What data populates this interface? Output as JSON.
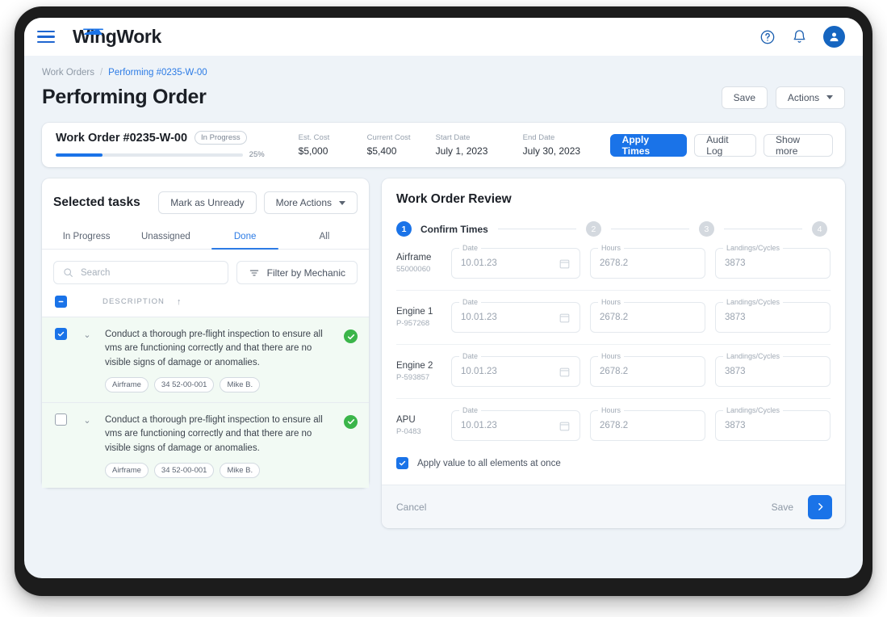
{
  "brand": {
    "name": "WingWork",
    "accent": "#1a73e8",
    "green": "#3bb54a"
  },
  "topnav": {
    "menu_icon": "hamburger-icon",
    "help_icon": "help-circle-icon",
    "notifications_icon": "bell-icon",
    "avatar_icon": "user-avatar-icon"
  },
  "breadcrumb": {
    "root": "Work Orders",
    "separator": "/",
    "current": "Performing #0235-W-00"
  },
  "header": {
    "title": "Performing Order",
    "save_label": "Save",
    "actions_label": "Actions"
  },
  "summary": {
    "title": "Work Order #0235-W-00",
    "status": "In Progress",
    "progress_pct": 25,
    "progress_label": "25%",
    "metrics": [
      {
        "label": "Est. Cost",
        "value": "$5,000"
      },
      {
        "label": "Current Cost",
        "value": "$5,400"
      },
      {
        "label": "Start Date",
        "value": "July 1, 2023"
      },
      {
        "label": "End Date",
        "value": "July 30, 2023"
      }
    ],
    "apply_times_label": "Apply Times",
    "audit_log_label": "Audit Log",
    "show_more_label": "Show more"
  },
  "tasks_panel": {
    "title": "Selected tasks",
    "mark_unready_label": "Mark as Unready",
    "more_actions_label": "More Actions",
    "tabs": [
      {
        "label": "In Progress",
        "active": false
      },
      {
        "label": "Unassigned",
        "active": false
      },
      {
        "label": "Done",
        "active": true
      },
      {
        "label": "All",
        "active": false
      }
    ],
    "search_placeholder": "Search",
    "search_value": "",
    "filter_label": "Filter by Mechanic",
    "column_header": "DESCRIPTION",
    "sort_arrow": "↑",
    "select_all_state": "indeterminate",
    "rows": [
      {
        "checked": true,
        "text": "Conduct a thorough pre-flight inspection to ensure all  vms are functioning correctly and that there are no visible signs of damage or anomalies.",
        "tags": [
          "Airframe",
          "34 52-00-001",
          "Mike B."
        ],
        "status_icon": "check-circle-icon"
      },
      {
        "checked": false,
        "text": "Conduct a thorough pre-flight inspection to ensure all  vms are functioning correctly and that there are no visible signs of damage or anomalies.",
        "tags": [
          "Airframe",
          "34 52-00-001",
          "Mike B."
        ],
        "status_icon": "check-circle-icon"
      }
    ]
  },
  "review_panel": {
    "title": "Work Order Review",
    "steps": [
      {
        "num": "1",
        "label": "Confirm Times",
        "active": true
      },
      {
        "num": "2",
        "label": "",
        "active": false
      },
      {
        "num": "3",
        "label": "",
        "active": false
      },
      {
        "num": "4",
        "label": "",
        "active": false
      }
    ],
    "field_labels": {
      "date": "Date",
      "hours": "Hours",
      "cycles": "Landings/Cycles"
    },
    "rows": [
      {
        "name": "Airframe",
        "serial": "55000060",
        "date": "10.01.23",
        "hours": "2678.2",
        "cycles": "3873"
      },
      {
        "name": "Engine 1",
        "serial": "P-957268",
        "date": "10.01.23",
        "hours": "2678.2",
        "cycles": "3873"
      },
      {
        "name": "Engine 2",
        "serial": "P-593857",
        "date": "10.01.23",
        "hours": "2678.2",
        "cycles": "3873"
      },
      {
        "name": "APU",
        "serial": "P-0483",
        "date": "10.01.23",
        "hours": "2678.2",
        "cycles": "3873"
      }
    ],
    "apply_all": {
      "checked": true,
      "label": "Apply value to all elements at once"
    },
    "footer": {
      "cancel_label": "Cancel",
      "save_label": "Save",
      "next_icon": "chevron-right-icon"
    }
  }
}
